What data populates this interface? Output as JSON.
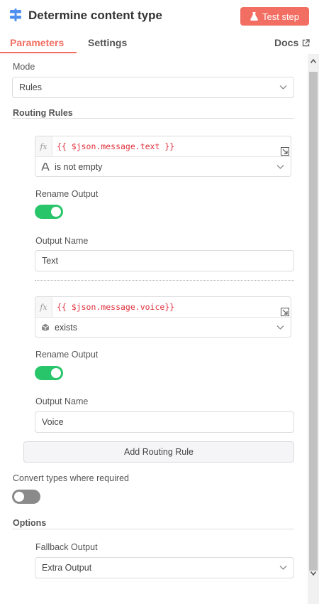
{
  "header": {
    "title": "Determine content type",
    "test_button": "Test step",
    "icon": "switch-icon",
    "accent": "#f26e62"
  },
  "tabs": {
    "parameters": "Parameters",
    "settings": "Settings",
    "docs": "Docs",
    "active": "Parameters"
  },
  "mode": {
    "label": "Mode",
    "value": "Rules"
  },
  "routing_rules": {
    "title": "Routing Rules",
    "rules": [
      {
        "expression": "{{ $json.message.text }}",
        "operator": "is not empty",
        "operator_icon": "text-type-icon",
        "rename_label": "Rename Output",
        "rename_on": true,
        "output_name_label": "Output Name",
        "output_name": "Text"
      },
      {
        "expression": "{{ $json.message.voice}}",
        "operator": "exists",
        "operator_icon": "cube-icon",
        "rename_label": "Rename Output",
        "rename_on": true,
        "output_name_label": "Output Name",
        "output_name": "Voice"
      }
    ],
    "add_button": "Add Routing Rule",
    "fx_label": "fx"
  },
  "convert_types": {
    "label": "Convert types where required",
    "on": false
  },
  "options": {
    "title": "Options",
    "fallback_label": "Fallback Output",
    "fallback_value": "Extra Output"
  },
  "colors": {
    "toggle_on": "#29c56b",
    "toggle_off": "#8a8a8a",
    "expression": "#e0323c"
  }
}
